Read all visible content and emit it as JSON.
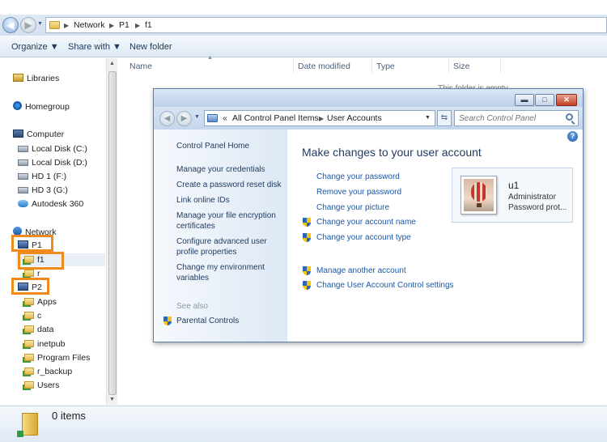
{
  "explorer": {
    "breadcrumb": [
      "Network",
      "P1",
      "f1"
    ],
    "toolbar": {
      "organize": "Organize",
      "share_with": "Share with",
      "new_folder": "New folder"
    },
    "columns": [
      "Name",
      "Date modified",
      "Type",
      "Size"
    ],
    "empty_message": "This folder is empty.",
    "nav": {
      "libraries": "Libraries",
      "homegroup": "Homegroup",
      "computer": "Computer",
      "drives": [
        "Local Disk (C:)",
        "Local Disk (D:)",
        "HD 1 (F:)",
        "HD 3 (G:)",
        "Autodesk 360"
      ],
      "network": "Network",
      "p1": "P1",
      "p1_children": [
        "f1",
        "r"
      ],
      "p2": "P2",
      "p2_children": [
        "Apps",
        "c",
        "data",
        "inetpub",
        "Program Files",
        "r_backup",
        "Users"
      ]
    },
    "status": "0 items"
  },
  "control_panel": {
    "breadcrumb_prefix": "«",
    "breadcrumb": [
      "All Control Panel Items",
      "User Accounts"
    ],
    "search_placeholder": "Search Control Panel",
    "left_links": [
      "Control Panel Home",
      "Manage your credentials",
      "Create a password reset disk",
      "Link online IDs",
      "Manage your file encryption certificates",
      "Configure advanced user profile properties",
      "Change my environment variables"
    ],
    "see_also_label": "See also",
    "see_also_links": [
      "Parental Controls"
    ],
    "heading": "Make changes to your user account",
    "tasks": [
      "Change your password",
      "Remove your password",
      "Change your picture",
      "Change your account name",
      "Change your account type"
    ],
    "admin_tasks": [
      "Manage another account",
      "Change User Account Control settings"
    ],
    "user": {
      "name": "u1",
      "role": "Administrator",
      "password_status": "Password prot..."
    },
    "help_icon": "?"
  },
  "accent_colors": {
    "highlight_box": "#f08a1c",
    "link": "#1a57a5"
  }
}
